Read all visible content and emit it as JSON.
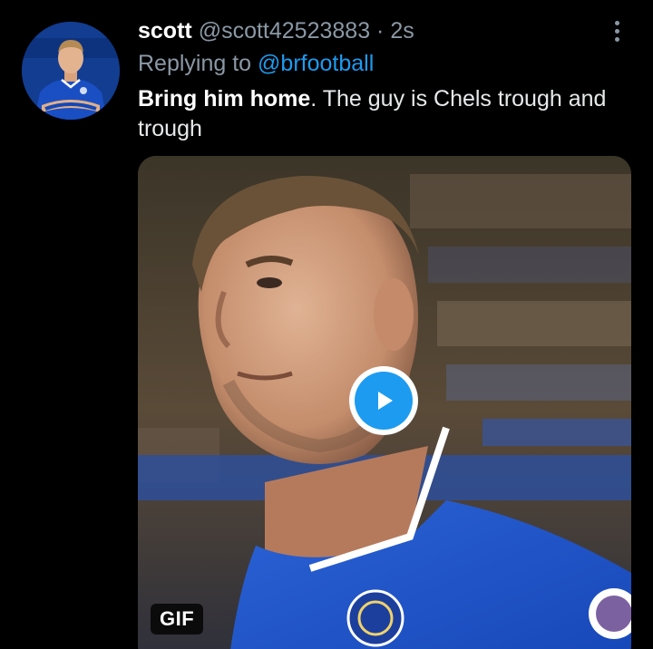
{
  "tweet": {
    "display_name": "scott",
    "handle": "@scott42523883",
    "separator": "·",
    "time": "2s",
    "replying_prefix": "Replying to",
    "replying_to": "@brfootball",
    "text_bold": "Bring him home",
    "text_rest": ". The guy is Chels trough and trough",
    "avatar_icon": "profile-photo",
    "more_icon": "vertical-dots-icon"
  },
  "media": {
    "badge": "GIF",
    "play_icon": "play-icon"
  },
  "colors": {
    "background": "#000000",
    "muted_text": "#8b98a5",
    "accent": "#1d9bf0",
    "primary_text": "#e7e9ea"
  }
}
